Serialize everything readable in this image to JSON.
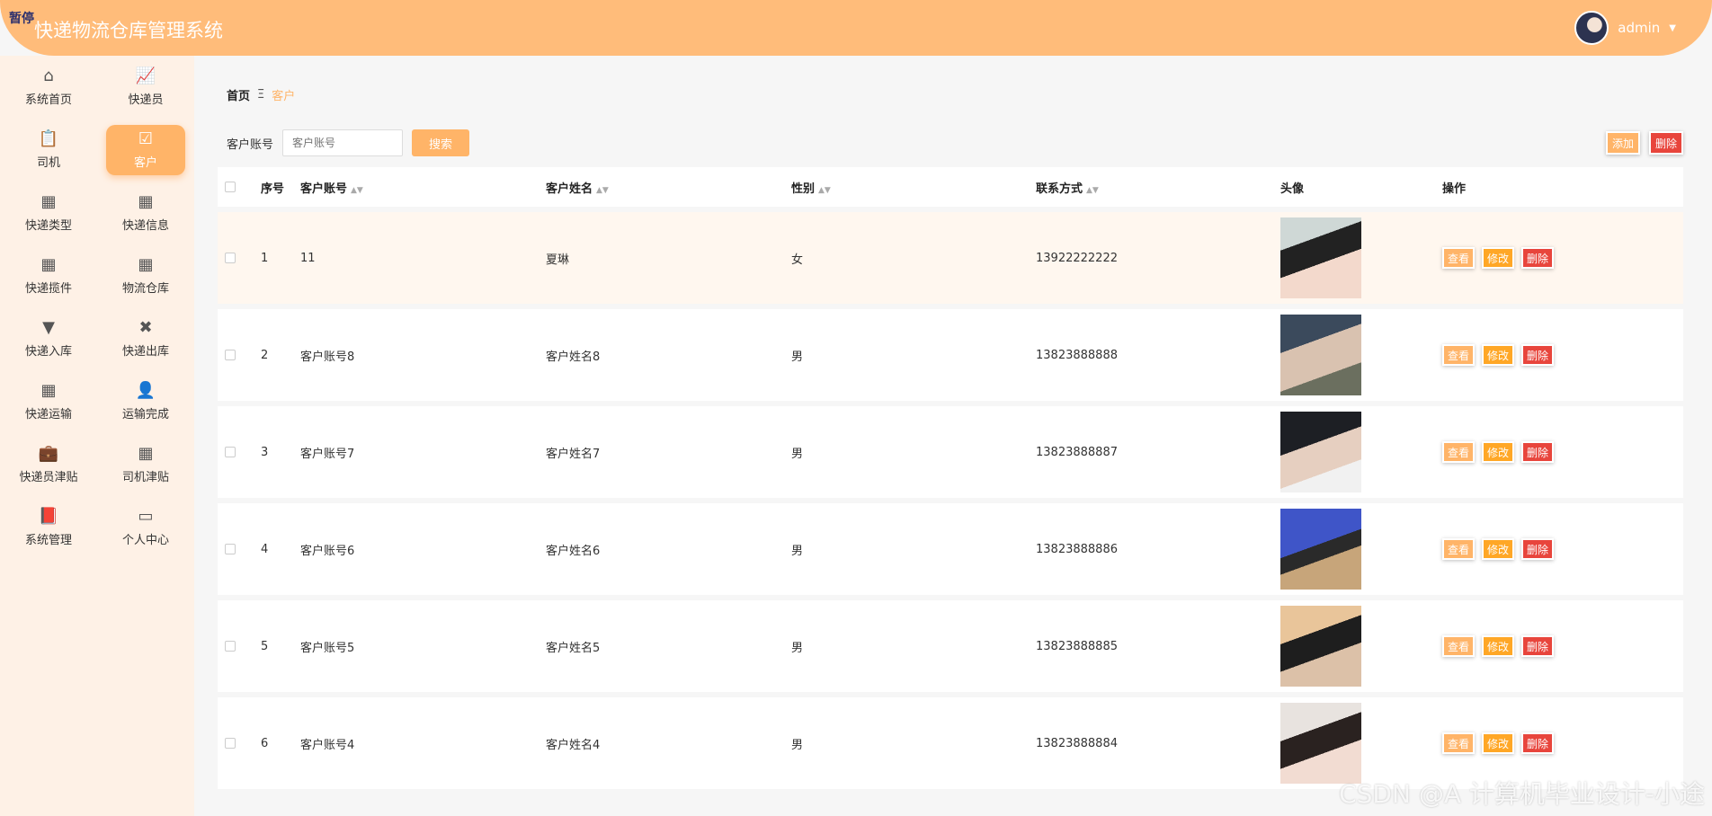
{
  "header": {
    "badge": "暂停",
    "title": "快递物流仓库管理系统",
    "user": "admin"
  },
  "sidebar": {
    "items": [
      {
        "label": "系统首页",
        "icon": "⌂",
        "icon_name": "home-icon"
      },
      {
        "label": "快递员",
        "icon": "📈",
        "icon_name": "chart-icon"
      },
      {
        "label": "司机",
        "icon": "📋",
        "icon_name": "clipboard-icon"
      },
      {
        "label": "客户",
        "icon": "☑",
        "icon_name": "clipboard-check-icon",
        "active": true
      },
      {
        "label": "快递类型",
        "icon": "▦",
        "icon_name": "grid-icon"
      },
      {
        "label": "快递信息",
        "icon": "▦",
        "icon_name": "grid-icon"
      },
      {
        "label": "快递揽件",
        "icon": "▦",
        "icon_name": "grid-icon"
      },
      {
        "label": "物流仓库",
        "icon": "▦",
        "icon_name": "grid-icon"
      },
      {
        "label": "快递入库",
        "icon": "▼",
        "icon_name": "brush-icon"
      },
      {
        "label": "快递出库",
        "icon": "✖",
        "icon_name": "clipboard-x-icon"
      },
      {
        "label": "快递运输",
        "icon": "▦",
        "icon_name": "grid-icon"
      },
      {
        "label": "运输完成",
        "icon": "👤",
        "icon_name": "user-icon"
      },
      {
        "label": "快递员津贴",
        "icon": "💼",
        "icon_name": "briefcase-icon"
      },
      {
        "label": "司机津贴",
        "icon": "▦",
        "icon_name": "grid-icon"
      },
      {
        "label": "系统管理",
        "icon": "📕",
        "icon_name": "book-icon"
      },
      {
        "label": "个人中心",
        "icon": "▭",
        "icon_name": "wallet-icon"
      }
    ]
  },
  "breadcrumb": {
    "home": "首页",
    "sep": "Ξ",
    "current": "客户"
  },
  "search": {
    "label": "客户账号",
    "placeholder": "客户账号",
    "button": "搜索"
  },
  "actions": {
    "add": "添加",
    "delete": "删除"
  },
  "table": {
    "headers": {
      "idx": "序号",
      "account": "客户账号",
      "name": "客户姓名",
      "sex": "性别",
      "phone": "联系方式",
      "avatar": "头像",
      "ops": "操作"
    },
    "op_labels": {
      "view": "查看",
      "edit": "修改",
      "delete": "删除"
    },
    "rows": [
      {
        "idx": "1",
        "account": "11",
        "name": "夏琳",
        "sex": "女",
        "phone": "13922222222"
      },
      {
        "idx": "2",
        "account": "客户账号8",
        "name": "客户姓名8",
        "sex": "男",
        "phone": "13823888888"
      },
      {
        "idx": "3",
        "account": "客户账号7",
        "name": "客户姓名7",
        "sex": "男",
        "phone": "13823888887"
      },
      {
        "idx": "4",
        "account": "客户账号6",
        "name": "客户姓名6",
        "sex": "男",
        "phone": "13823888886"
      },
      {
        "idx": "5",
        "account": "客户账号5",
        "name": "客户姓名5",
        "sex": "男",
        "phone": "13823888885"
      },
      {
        "idx": "6",
        "account": "客户账号4",
        "name": "客户姓名4",
        "sex": "男",
        "phone": "13823888884"
      }
    ]
  },
  "watermark": "CSDN @A 计算机毕业设计-小途"
}
